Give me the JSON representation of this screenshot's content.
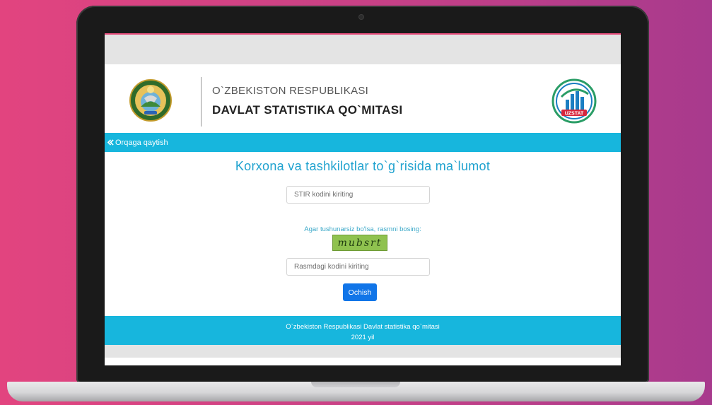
{
  "header": {
    "org_line1": "O`ZBEKISTON RESPUBLIKASI",
    "org_line2": "DAVLAT STATISTIKA QO`MITASI",
    "logo_text": "UZSTAT"
  },
  "nav": {
    "back_icon": "double-chevron-left-icon",
    "back_label": "Orqaga qaytish"
  },
  "form": {
    "title": "Korxona va tashkilotlar to`g`risida ma`lumot",
    "stir_placeholder": "STIR kodini kiriting",
    "captcha_hint": "Agar tushunarsiz bo'lsa, rasmni bosing:",
    "captcha_text": "mubsrt",
    "captcha_code_placeholder": "Rasmdagi kodini kiriting",
    "submit_label": "Ochish"
  },
  "footer": {
    "line1": "O`zbekiston Respublikasi Davlat statistika qo`mitasi",
    "line2": "2021 yil"
  },
  "colors": {
    "accent": "#17b6dd",
    "title": "#1fa2cf",
    "button": "#1175e8",
    "background": "#e2447f"
  }
}
